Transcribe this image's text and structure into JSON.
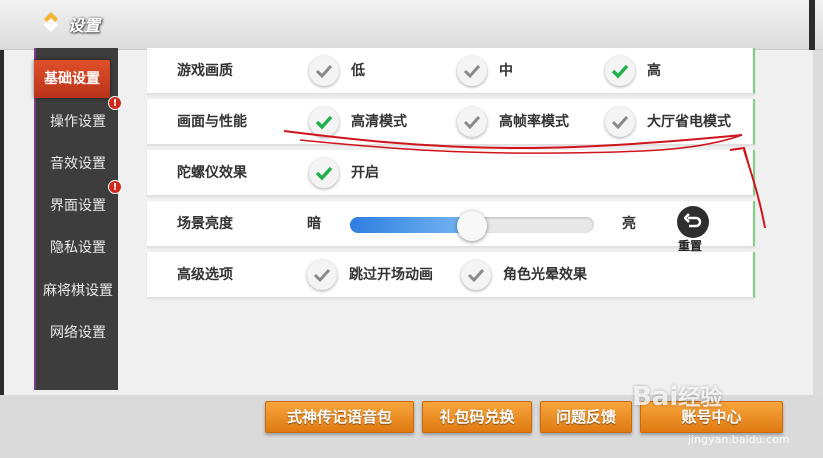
{
  "window": {
    "title": "设置"
  },
  "sidebar": {
    "items": [
      {
        "label": "基础设置",
        "active": true,
        "badge": ""
      },
      {
        "label": "操作设置",
        "active": false,
        "badge": "!"
      },
      {
        "label": "音效设置",
        "active": false,
        "badge": ""
      },
      {
        "label": "界面设置",
        "active": false,
        "badge": "!"
      },
      {
        "label": "隐私设置",
        "active": false,
        "badge": ""
      },
      {
        "label": "麻将棋设置",
        "active": false,
        "badge": ""
      },
      {
        "label": "网络设置",
        "active": false,
        "badge": ""
      }
    ]
  },
  "settings": {
    "graphics_quality": {
      "label": "游戏画质",
      "options": [
        {
          "label": "低",
          "checked": false
        },
        {
          "label": "中",
          "checked": false
        },
        {
          "label": "高",
          "checked": true
        }
      ]
    },
    "performance": {
      "label": "画面与性能",
      "options": [
        {
          "label": "高清模式",
          "checked": true
        },
        {
          "label": "高帧率模式",
          "checked": false
        },
        {
          "label": "大厅省电模式",
          "checked": false
        }
      ]
    },
    "gyroscope": {
      "label": "陀螺仪效果",
      "options": [
        {
          "label": "开启",
          "checked": true
        }
      ]
    },
    "brightness": {
      "label": "场景亮度",
      "dark_label": "暗",
      "bright_label": "亮",
      "value": 0.5,
      "reset_label": "重置"
    },
    "advanced": {
      "label": "高级选项",
      "options": [
        {
          "label": "跳过开场动画",
          "checked": false
        },
        {
          "label": "角色光晕效果",
          "checked": false
        }
      ]
    }
  },
  "bottom_buttons": {
    "voice_pack": "式神传记语音包",
    "gift_code": "礼包码兑换",
    "feedback": "问题反馈",
    "account": "账号中心"
  },
  "watermark": {
    "brand": "Bai经验",
    "url": "jingyan.baidu.com"
  },
  "colors": {
    "accent": "#e0502a",
    "check_green": "#22b14c",
    "check_gray": "#8a8a8a",
    "button_orange": "#f29a2e",
    "slider_blue": "#2f7de0",
    "annotation_red": "#d0141c"
  }
}
